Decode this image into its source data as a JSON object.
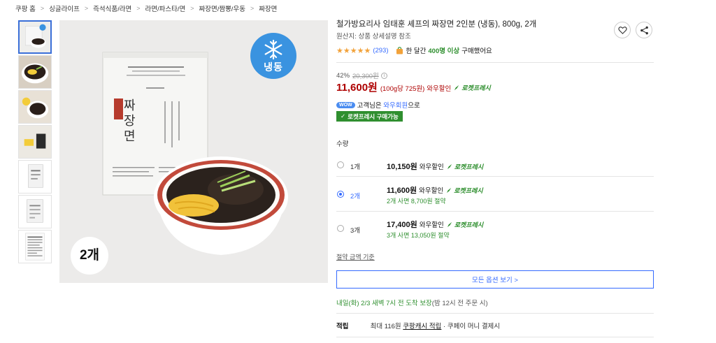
{
  "breadcrumb": [
    "쿠팡 홈",
    "싱글라이프",
    "즉석식품/라면",
    "라면/파스타/면",
    "짜장면/짬뽕/우동",
    "짜장면"
  ],
  "breadcrumb_sep": ">",
  "product": {
    "title": "철가방요리사 임태훈 셰프의 짜장면 2인분 (냉동), 800g, 2개",
    "origin_label": "원산지:",
    "origin_value": "상품 상세설명 참조",
    "stars": "★★★★★",
    "rating_count": "(293)",
    "bought_prefix": "한 달간",
    "bought_count": "400명 이상",
    "bought_suffix": "구매했어요",
    "discount_pct": "42%",
    "original_price": "20,300원",
    "price": "11,600원",
    "unit_price": "(100g당 725원)",
    "wow_tag": "와우할인",
    "rocket_label": "로켓프레시",
    "wow_pill": "WOW",
    "wow_text_pre": "고객님은",
    "wow_member": "와우회원",
    "wow_text_post": "으로",
    "rocket_available": "로켓프레시 구매가능"
  },
  "image": {
    "frozen_badge": "냉동",
    "count_badge": "2개",
    "package_title": "짜장면",
    "package_chars": [
      "짜",
      "장",
      "면"
    ]
  },
  "quantity": {
    "label": "수량",
    "options": [
      {
        "qty": "1개",
        "price": "10,150원",
        "tag": "와우할인",
        "rocket": "로켓프레시",
        "save": "",
        "selected": false
      },
      {
        "qty": "2개",
        "price": "11,600원",
        "tag": "와우할인",
        "rocket": "로켓프레시",
        "save": "2개 사면 8,700원 절약",
        "selected": true
      },
      {
        "qty": "3개",
        "price": "17,400원",
        "tag": "와우할인",
        "rocket": "로켓프레시",
        "save": "3개 사면 13,050원 절약",
        "selected": false
      }
    ],
    "save_basis": "절약 금액 기준",
    "all_options": "모든 옵션 보기 >"
  },
  "delivery": {
    "main": "내일(화) 2/3 새벽 7시 전 도착 보장",
    "note": "(밤 12시 전 주문 시)"
  },
  "points": {
    "label": "적립",
    "text_pre": "최대 116원",
    "link": "쿠팡캐시 적립",
    "text_post": "· 쿠페이 머니 결제시"
  },
  "colors": {
    "price_red": "#ae0000",
    "rocket_green": "#2f8f2f",
    "link_blue": "#346aff",
    "frozen_blue": "#3a93e0",
    "star_orange": "#f2a23a"
  },
  "icons": [
    "heart-icon",
    "share-icon",
    "snowflake-icon",
    "rocket-icon",
    "bag-icon",
    "check-icon"
  ]
}
